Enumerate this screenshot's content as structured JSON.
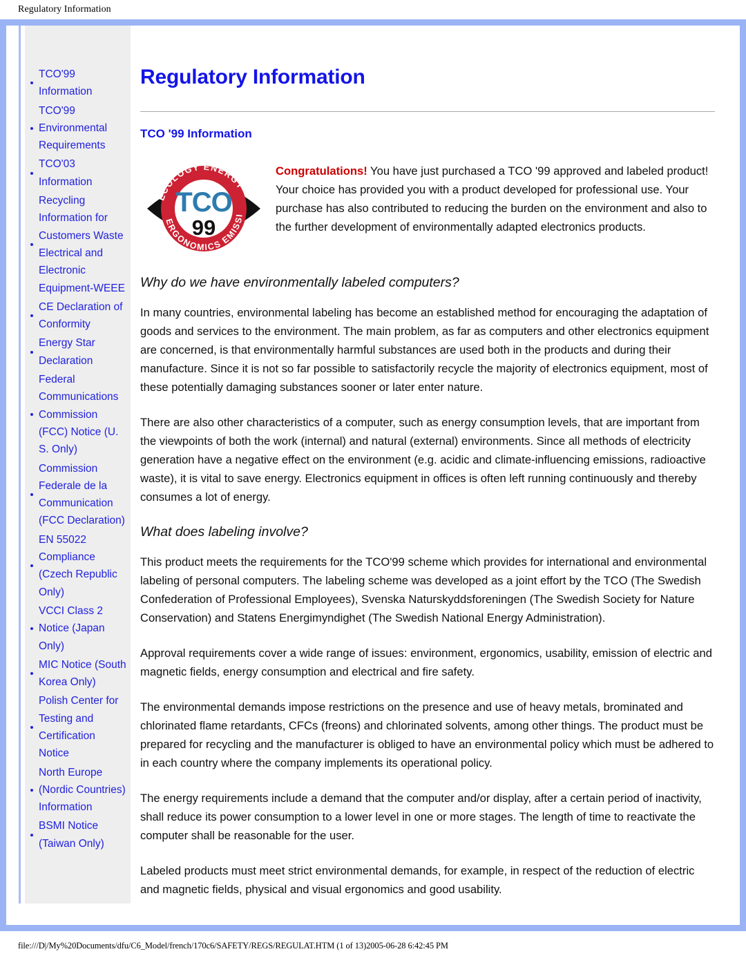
{
  "running_head": "Regulatory Information",
  "colors": {
    "frame_blue": "#99b3f5",
    "link_blue": "#2222dd",
    "title_blue": "#1414e6",
    "sidebar_gray": "#eeeeee",
    "congrats_red": "#cc0000",
    "logo_red": "#cc2233",
    "logo_tco_blue": "#2e7cae"
  },
  "sidebar": {
    "items": [
      {
        "label": "TCO'99 Information"
      },
      {
        "label": "TCO'99 Environmental Requirements"
      },
      {
        "label": "TCO'03 Information"
      },
      {
        "label": "Recycling Information for Customers Waste Electrical and Electronic Equipment-WEEE"
      },
      {
        "label": "CE Declaration of Conformity"
      },
      {
        "label": "Energy Star Declaration"
      },
      {
        "label": "Federal Communications Commission (FCC) Notice (U. S. Only)"
      },
      {
        "label": "Commission Federale de la Communication (FCC Declaration)"
      },
      {
        "label": "EN 55022 Compliance (Czech Republic Only)"
      },
      {
        "label": "VCCI Class 2 Notice (Japan Only)"
      },
      {
        "label": "MIC Notice (South Korea Only)"
      },
      {
        "label": "Polish Center for Testing and Certification Notice"
      },
      {
        "label": "North Europe (Nordic Countries) Information"
      },
      {
        "label": "BSMI Notice (Taiwan Only)"
      }
    ]
  },
  "main": {
    "title": "Regulatory Information",
    "section_title": "TCO '99 Information",
    "logo": {
      "name": "tco-99-certification-logo",
      "center_text": "TCO",
      "year_text": "99",
      "ring_words": [
        "ECOLOGY",
        "ENERGY",
        "ERGONOMICS",
        "EMISSIONS"
      ]
    },
    "intro": {
      "lead": "Congratulations!",
      "rest": " You have just purchased a TCO '99 approved and labeled product! Your choice has provided you with a product developed for professional use. Your purchase has also contributed to reducing the burden on the environment and also to the further development of environmentally adapted electronics products."
    },
    "heading_1": "Why do we have environmentally labeled computers?",
    "para_1": "In many countries, environmental labeling has become an established method for encouraging the adaptation of goods and services to the environment. The main problem, as far as computers and other electronics equipment are concerned, is that environmentally harmful substances are used both in the products and during their manufacture. Since it is not so far possible to satisfactorily recycle the majority of electronics equipment, most of these potentially damaging substances sooner or later enter nature.",
    "para_2": "There are also other characteristics of a computer, such as energy consumption levels, that are important from the viewpoints of both the work (internal) and natural (external) environments. Since all methods of electricity generation have a negative effect on the environment (e.g. acidic and climate-influencing emissions, radioactive waste), it is vital to save energy. Electronics equipment in offices is often left running continuously and thereby consumes a lot of energy.",
    "heading_2": "What does labeling involve?",
    "para_3": "This product meets the requirements for the TCO'99 scheme which provides for international and environmental labeling of personal computers. The labeling scheme was developed as a joint effort by the TCO (The Swedish Confederation of Professional Employees), Svenska Naturskyddsforeningen (The Swedish Society for Nature Conservation) and Statens Energimyndighet (The Swedish National Energy Administration).",
    "para_4": "Approval requirements cover a wide range of issues: environment, ergonomics, usability, emission of electric and magnetic fields, energy consumption and electrical and fire safety.",
    "para_5": "The environmental demands impose restrictions on the presence and use of heavy metals, brominated and chlorinated flame retardants, CFCs (freons) and chlorinated solvents, among other things. The product must be prepared for recycling and the manufacturer is obliged to have an environmental policy which must be adhered to in each country where the company implements its operational policy.",
    "para_6": "The energy requirements include a demand that the computer and/or display, after a certain period of inactivity, shall reduce its power consumption to a lower level in one or more stages. The length of time to reactivate the computer shall be reasonable for the user.",
    "para_7": "Labeled products must meet strict environmental demands, for example, in respect of the reduction of electric and magnetic fields, physical and visual ergonomics and good usability."
  },
  "footer": {
    "path": "file:///D|/My%20Documents/dfu/C6_Model/french/170c6/SAFETY/REGS/REGULAT.HTM (1 of 13)2005-06-28 6:42:45 PM"
  }
}
